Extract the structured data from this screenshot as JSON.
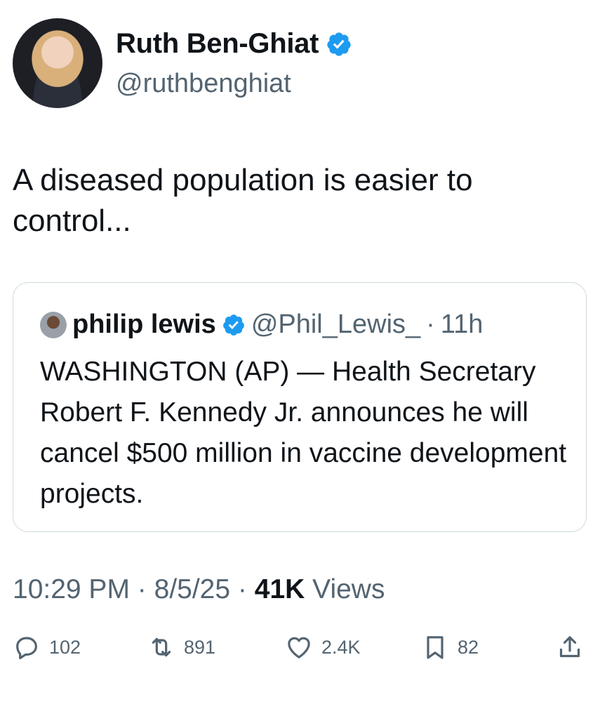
{
  "author": {
    "display_name": "Ruth Ben-Ghiat",
    "handle": "@ruthbenghiat"
  },
  "tweet": {
    "text": "A diseased population is easier to control..."
  },
  "quoted": {
    "display_name": "philip lewis",
    "handle": "@Phil_Lewis_",
    "separator": "·",
    "age": "11h",
    "text": "WASHINGTON (AP) — Health Secretary Robert F. Kennedy Jr. announces he will cancel $500 million in vaccine development projects."
  },
  "meta": {
    "time": "10:29 PM",
    "sep1": "·",
    "date": "8/5/25",
    "sep2": "·",
    "views_count": "41K",
    "views_label": "Views"
  },
  "actions": {
    "replies": "102",
    "reposts": "891",
    "likes": "2.4K",
    "bookmarks": "82"
  },
  "colors": {
    "verified": "#1d9bf0",
    "secondary_text": "#536471",
    "border": "#cfd9de"
  }
}
